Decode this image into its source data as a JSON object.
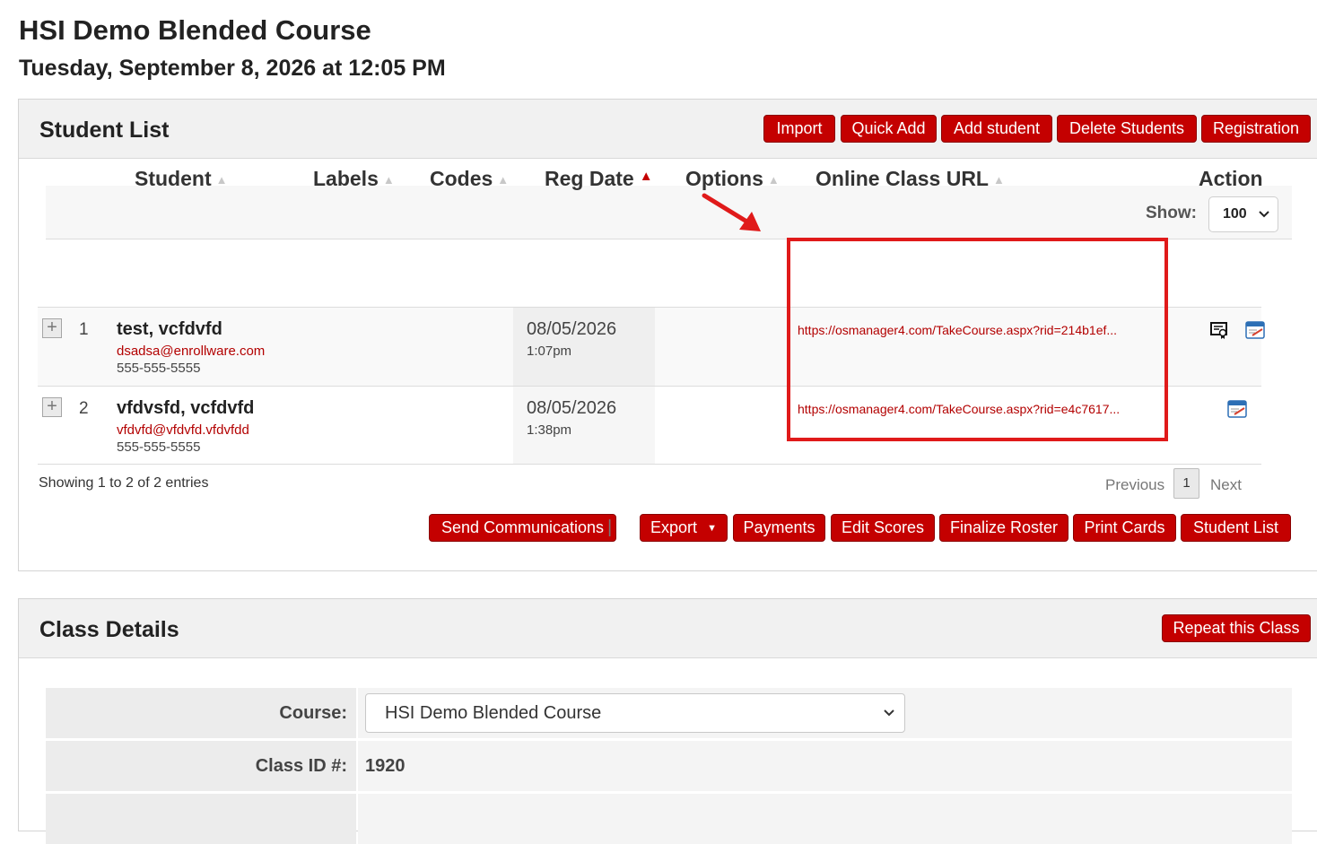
{
  "page": {
    "title": "HSI Demo Blended Course",
    "datetime": "Tuesday, September 8, 2026 at 12:05 PM"
  },
  "student_list": {
    "title": "Student List",
    "header_buttons": [
      "Import",
      "Quick Add",
      "Add student",
      "Delete Students",
      "Registration"
    ],
    "show_label": "Show:",
    "show_value": "100",
    "columns": {
      "student": "Student",
      "labels": "Labels",
      "codes": "Codes",
      "reg_date": "Reg Date",
      "options": "Options",
      "online_url": "Online Class URL",
      "action": "Action"
    },
    "rows": [
      {
        "num": "1",
        "name": "test, vcfdvfd",
        "email": "dsadsa@enrollware.com",
        "phone": "555-555-5555",
        "reg_date": "08/05/2026",
        "reg_time": "1:07pm",
        "url": "https://osmanager4.com/TakeCourse.aspx?rid=214b1ef..."
      },
      {
        "num": "2",
        "name": "vfdvsfd, vcfdvfd",
        "email": "vfdvfd@vfdvfd.vfdvfdd",
        "phone": "555-555-5555",
        "reg_date": "08/05/2026",
        "reg_time": "1:38pm",
        "url": "https://osmanager4.com/TakeCourse.aspx?rid=e4c7617..."
      }
    ],
    "info": "Showing 1 to 2 of 2 entries",
    "pagination": {
      "previous": "Previous",
      "current": "1",
      "next": "Next"
    },
    "separator": "|",
    "footer_buttons": {
      "send": "Send Communications",
      "export": "Export",
      "payments": "Payments",
      "edit_scores": "Edit Scores",
      "finalize": "Finalize Roster",
      "print": "Print Cards",
      "student_list": "Student List"
    }
  },
  "class_details": {
    "title": "Class Details",
    "repeat_button": "Repeat this Class",
    "course_label": "Course:",
    "course_value": "HSI Demo Blended Course",
    "class_id_label": "Class ID #:",
    "class_id_value": "1920"
  },
  "colors": {
    "accent_red": "#c40000",
    "highlight_box": "#e01a1a",
    "link_red": "#b30000"
  },
  "icons": [
    "plus-expand-icon",
    "certificate-icon",
    "calendar-edit-icon",
    "sort-icon",
    "chevron-down-icon",
    "annotation-arrow"
  ]
}
